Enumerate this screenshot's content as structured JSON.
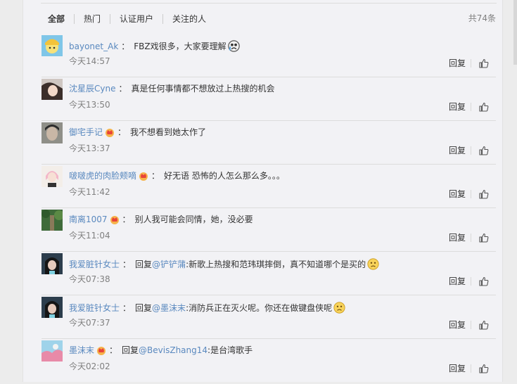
{
  "tabs": [
    "全部",
    "热门",
    "认证用户",
    "关注的人"
  ],
  "total_count": "共74条",
  "colors": {
    "link": "#5a89bf",
    "time": "#808080",
    "bg": "#f2f2f5"
  },
  "comments": [
    {
      "user": "bayonet_Ak",
      "vip": false,
      "text": "FBZ戏很多，大家要理解",
      "time": "今天14:57",
      "emoji": "crying-face-emoji"
    },
    {
      "user": "沈星辰Cyne",
      "vip": false,
      "text": "真是任何事情都不想放过上热搜的机会",
      "time": "今天13:50"
    },
    {
      "user": "御宅手记",
      "vip": true,
      "text": "我不想看到她太作了",
      "time": "今天13:37"
    },
    {
      "user": "啵啵虎的肉脸颊嘀",
      "vip": true,
      "text": "好无语 恐怖的人怎么那么多。。。",
      "time": "今天11:42"
    },
    {
      "user": "南离1007",
      "vip": true,
      "text": "别人我可能会同情，她，没必要",
      "time": "今天11:04"
    },
    {
      "user": "我爱脏针女士",
      "vip": false,
      "reply_prefix": "回复",
      "reply_to": "@铲铲蒲",
      "text": ":新歌上热搜和范玮琪摔倒，真不知道哪个是买的",
      "time": "今天07:38",
      "emoji": "sad-face-emoji"
    },
    {
      "user": "我爱脏针女士",
      "vip": false,
      "reply_prefix": "回复",
      "reply_to": "@墨沫末",
      "text": ":消防兵正在灭火呢。你还在做键盘侠呢",
      "time": "今天07:37",
      "emoji": "sad-face-emoji"
    },
    {
      "user": "墨沫末",
      "vip": true,
      "reply_prefix": "回复",
      "reply_to": "@BevisZhang14",
      "text": ":是台湾歌手",
      "time": "今天02:02"
    }
  ],
  "reply_label": "回复"
}
